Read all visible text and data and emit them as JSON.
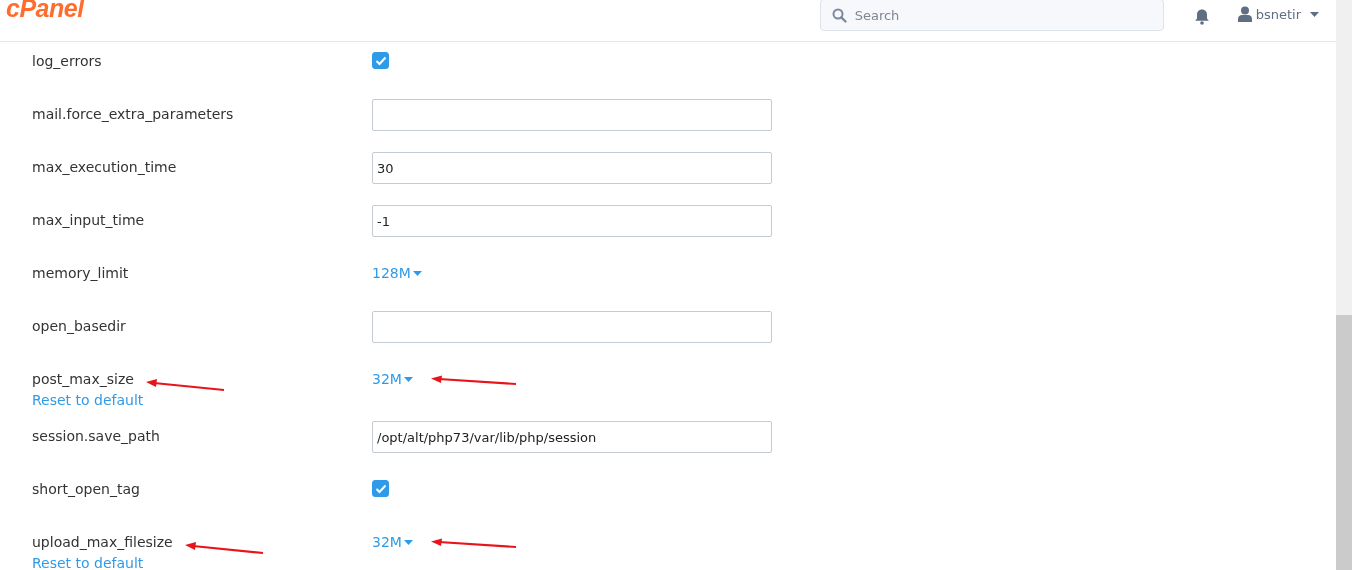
{
  "header": {
    "logo": "cPanel",
    "search": {
      "placeholder": "Search"
    },
    "user": {
      "name": "bsnetir"
    }
  },
  "settings": [
    {
      "name": "log_errors",
      "kind": "checkbox",
      "checked": true,
      "annotated": false
    },
    {
      "name": "mail.force_extra_parameters",
      "kind": "text",
      "annotated": false
    },
    {
      "name": "max_execution_time",
      "kind": "text",
      "value": "30",
      "annotated": false
    },
    {
      "name": "max_input_time",
      "kind": "text",
      "value": "-1",
      "annotated": false
    },
    {
      "name": "memory_limit",
      "kind": "select",
      "value": "128M",
      "annotated": false
    },
    {
      "name": "open_basedir",
      "kind": "text",
      "annotated": false
    },
    {
      "name": "post_max_size",
      "kind": "select",
      "value": "32M",
      "reset": "Reset to default",
      "annotated": true
    },
    {
      "name": "session.save_path",
      "kind": "text",
      "value": "/opt/alt/php73/var/lib/php/session",
      "annotated": false
    },
    {
      "name": "short_open_tag",
      "kind": "checkbox",
      "checked": true,
      "annotated": false
    },
    {
      "name": "upload_max_filesize",
      "kind": "select",
      "value": "32M",
      "reset": "Reset to default",
      "annotated": true
    }
  ]
}
